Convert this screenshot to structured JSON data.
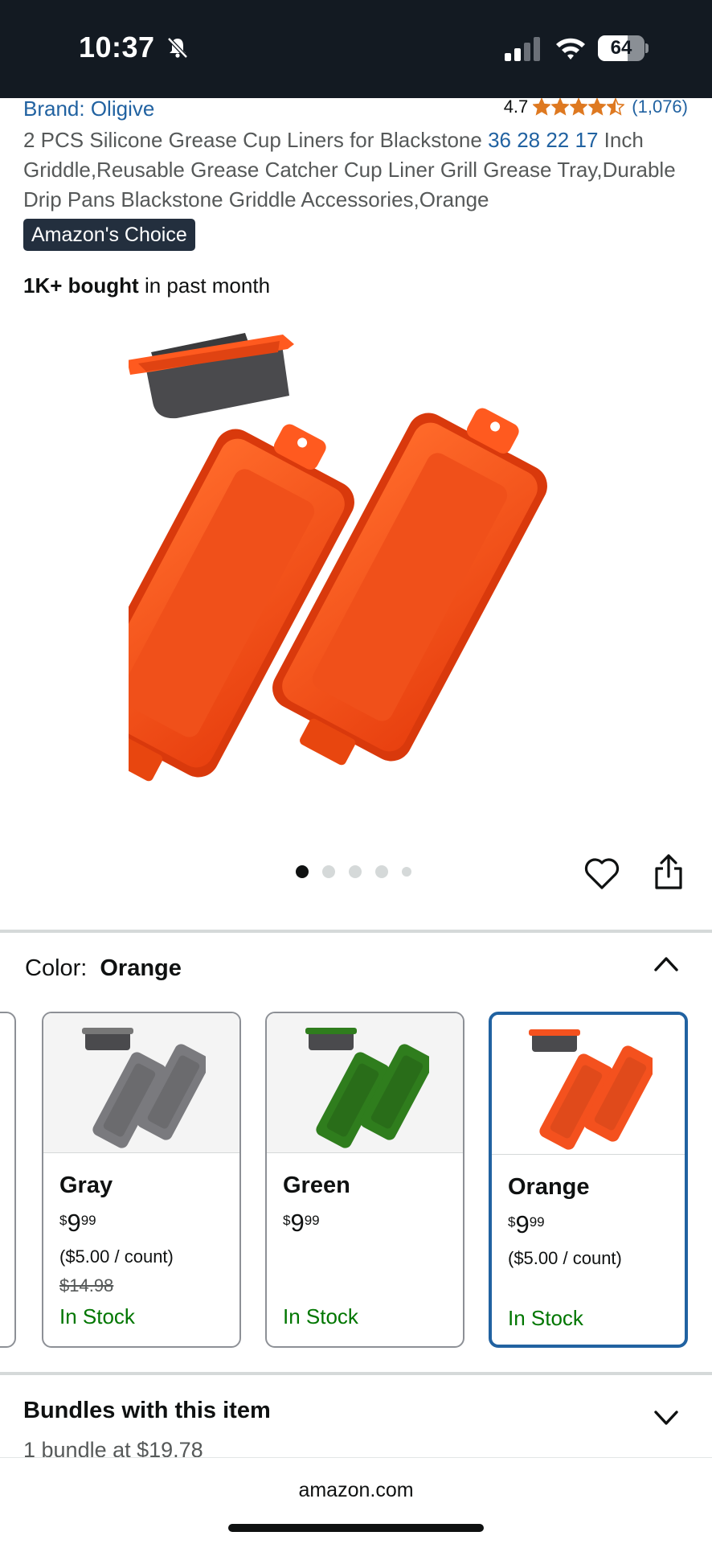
{
  "status_bar": {
    "time": "10:37",
    "battery_level": "64",
    "battery_fraction": 0.64
  },
  "product": {
    "brand_link": "Brand: Oligive",
    "rating_value": "4.7",
    "rating_stars": 4.5,
    "rating_count": "(1,076)",
    "title_part1": "2 PCS Silicone Grease Cup Liners for Blackstone ",
    "title_sizes": "36 28 22 17",
    "title_part2": " Inch Griddle,Reusable Grease Catcher Cup Liner Grill Grease Tray,Durable Drip Pans Blackstone Griddle Accessories,Orange",
    "badge": "Amazon's Choice",
    "bought_bold": "1K+ bought",
    "bought_rest": " in past month"
  },
  "carousel": {
    "image_count": 5,
    "active_index": 0
  },
  "color_section": {
    "label": "Color:",
    "selected": "Orange"
  },
  "swatches": [
    {
      "name": "Gray",
      "price_symbol": "$",
      "price_whole": "9",
      "price_fraction": "99",
      "unit_price": "($5.00 / count)",
      "old_price": "$14.98",
      "stock": "In Stock",
      "color": "#7a7a7e"
    },
    {
      "name": "Green",
      "price_symbol": "$",
      "price_whole": "9",
      "price_fraction": "99",
      "unit_price": "",
      "old_price": "",
      "stock": "In Stock",
      "color": "#2f7d1d"
    },
    {
      "name": "Orange",
      "price_symbol": "$",
      "price_whole": "9",
      "price_fraction": "99",
      "unit_price": "($5.00 / count)",
      "old_price": "",
      "stock": "In Stock",
      "color": "#f4511e"
    }
  ],
  "bundles": {
    "title": "Bundles with this item",
    "subtitle": "1 bundle at $19.78"
  },
  "browser": {
    "url": "amazon.com"
  },
  "colors": {
    "header_bg": "#131a22",
    "link": "#2162a1",
    "star": "#de7921",
    "in_stock": "#007600",
    "product_orange": "#f4511e",
    "selected_border": "#2162a1"
  }
}
